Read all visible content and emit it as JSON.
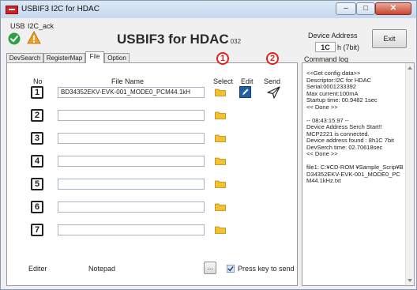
{
  "window": {
    "title": "USBIF3 I2C for HDAC",
    "min": "‒",
    "max": "□",
    "close": "✕"
  },
  "status": {
    "usb_label": "USB",
    "i2c_label": "I2C_ack",
    "usb_state": "ok",
    "i2c_state": "warning"
  },
  "header": {
    "brand": "USBIF3 for HDAC",
    "version": "032"
  },
  "device_address": {
    "label": "Device Address",
    "value": "1C",
    "suffix": "h (7bit)"
  },
  "exit_label": "Exit",
  "tabs": [
    {
      "label": "DevSearch"
    },
    {
      "label": "RegisterMap"
    },
    {
      "label": "File",
      "active": true
    },
    {
      "label": "Option"
    }
  ],
  "file_tab": {
    "col_no": "No",
    "col_filename": "File Name",
    "col_select": "Select",
    "col_edit": "Edit",
    "col_send": "Send",
    "marker_select": "1",
    "marker_send": "2",
    "rows": [
      {
        "no": "1",
        "filename": "BD34352EKV-EVK-001_MODE0_PCM44.1kH"
      },
      {
        "no": "2",
        "filename": ""
      },
      {
        "no": "3",
        "filename": ""
      },
      {
        "no": "4",
        "filename": ""
      },
      {
        "no": "5",
        "filename": ""
      },
      {
        "no": "6",
        "filename": ""
      },
      {
        "no": "7",
        "filename": ""
      }
    ],
    "editor_label": "Editer",
    "editor_value": "Notepad",
    "browse_label": "...",
    "press_key_label": "Press key to send",
    "press_key_checked": true
  },
  "command_log": {
    "label": "Command log",
    "text": "<<Get config data>>\nDescriptor:I2C for HDAC\nSerial:0001233392\nMax current:100mA\nStartup time: 00.9482 1sec\n<< Done >>\n\n-- 08:43:15.97 --\nDevice Address Serch Start!!\nMCP2221 is connected.\nDevice address found : 8h1C 7bit\nDevSerch time: 02.70618sec\n<< Done >>\n\nfile1: C:¥CD-ROM ¥Sample_Scrip¥BD34352EKV-EVK-001_MODE0_PCM44.1kHz.txt"
  },
  "colors": {
    "ok": "#2ea043",
    "warning": "#f0a020",
    "marker": "#e0201a",
    "folder": "#f2c233",
    "edit": "#1f5fa8"
  }
}
